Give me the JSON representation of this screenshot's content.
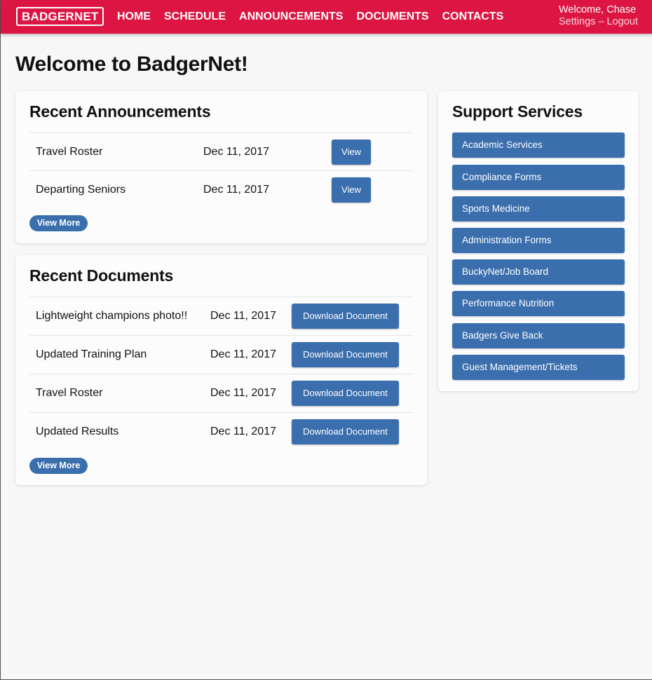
{
  "header": {
    "logo": "BADGERNET",
    "nav": [
      "HOME",
      "SCHEDULE",
      "ANNOUNCEMENTS",
      "DOCUMENTS",
      "CONTACTS"
    ],
    "welcome": "Welcome, Chase",
    "settings": "Settings",
    "separator": "–",
    "logout": "Logout"
  },
  "page": {
    "title": "Welcome to BadgerNet!"
  },
  "announcements": {
    "title": "Recent Announcements",
    "items": [
      {
        "title": "Travel Roster",
        "date": "Dec 11, 2017",
        "action": "View"
      },
      {
        "title": "Departing Seniors",
        "date": "Dec 11, 2017",
        "action": "View"
      }
    ],
    "view_more": "View More"
  },
  "documents": {
    "title": "Recent Documents",
    "items": [
      {
        "title": "Lightweight champions photo!!",
        "date": "Dec 11, 2017",
        "action": "Download Document"
      },
      {
        "title": "Updated Training Plan",
        "date": "Dec 11, 2017",
        "action": "Download Document"
      },
      {
        "title": "Travel Roster",
        "date": "Dec 11, 2017",
        "action": "Download Document"
      },
      {
        "title": "Updated Results",
        "date": "Dec 11, 2017",
        "action": "Download Document"
      }
    ],
    "view_more": "View More"
  },
  "support": {
    "title": "Support Services",
    "items": [
      "Academic Services",
      "Compliance Forms",
      "Sports Medicine",
      "Administration Forms",
      "BuckyNet/Job Board",
      "Performance Nutrition",
      "Badgers Give Back",
      "Guest Management/Tickets"
    ]
  },
  "colors": {
    "brand": "#dc1543",
    "accent": "#3a6ead",
    "background": "#f7f7f7"
  }
}
